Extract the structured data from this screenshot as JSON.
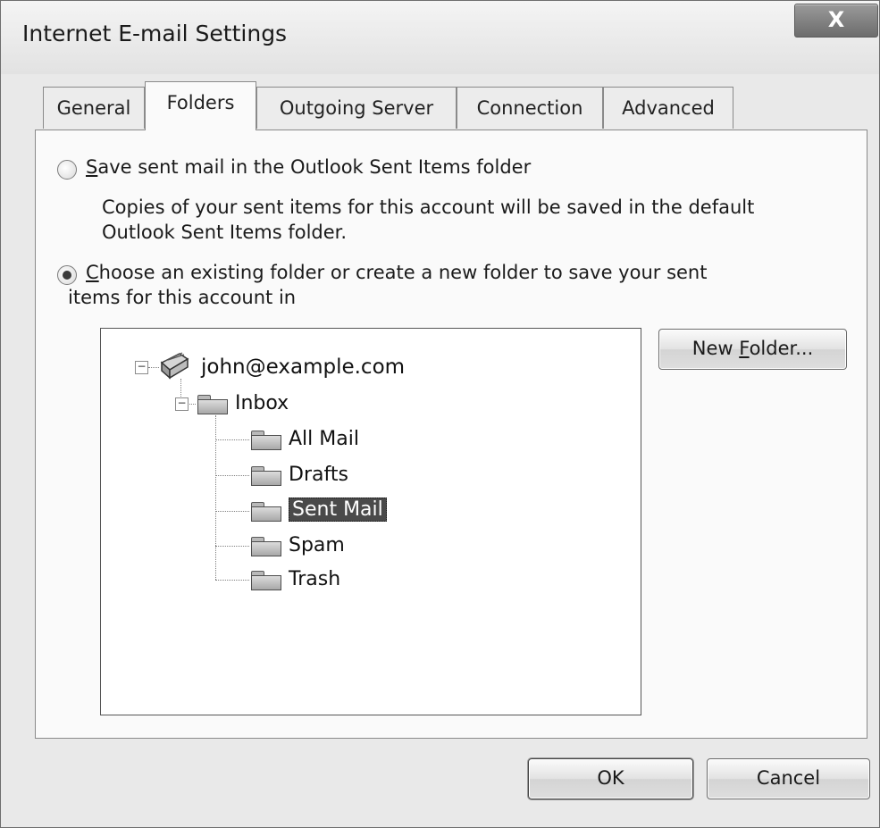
{
  "window": {
    "title": "Internet E-mail Settings",
    "close_label": "X"
  },
  "tabs": [
    {
      "label": "General",
      "active": false
    },
    {
      "label": "Folders",
      "active": true
    },
    {
      "label": "Outgoing Server",
      "active": false
    },
    {
      "label": "Connection",
      "active": false
    },
    {
      "label": "Advanced",
      "active": false
    }
  ],
  "options": {
    "save_sent": {
      "label_mnemonic": "S",
      "label_rest": "ave sent mail in the Outlook Sent Items folder",
      "selected": false,
      "description_line1": "Copies of your sent items for this account will be saved in the default",
      "description_line2": "Outlook Sent Items folder."
    },
    "choose_folder": {
      "label_mnemonic": "C",
      "label_line1_rest": "hoose an existing folder or create a new folder to save your sent",
      "label_line2": "items for this account in",
      "selected": true
    }
  },
  "tree": {
    "account": "john@example.com",
    "inbox": "Inbox",
    "folders": [
      "All Mail",
      "Drafts",
      "Sent Mail",
      "Spam",
      "Trash"
    ],
    "selected_folder": "Sent Mail"
  },
  "buttons": {
    "new_folder_prefix": "New ",
    "new_folder_mnemonic": "F",
    "new_folder_rest": "older...",
    "ok": "OK",
    "cancel": "Cancel"
  }
}
